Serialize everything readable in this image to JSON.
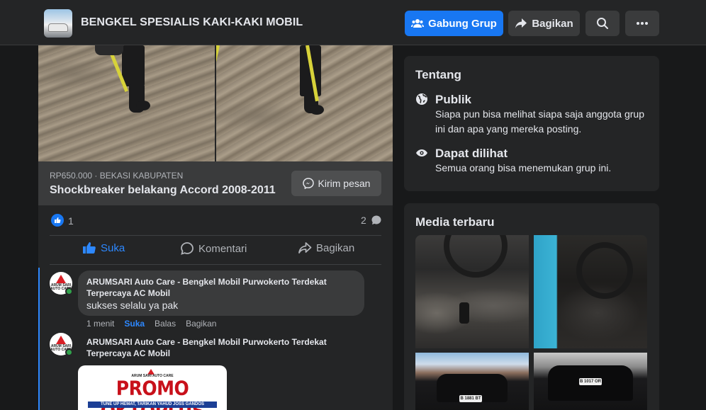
{
  "header": {
    "group_name": "BENGKEL SPESIALIS KAKI-KAKI MOBIL",
    "join_label": "Gabung Grup",
    "share_label": "Bagikan"
  },
  "listing": {
    "price_location": "RP650.000 · BEKASI KABUPATEN",
    "title": "Shockbreaker belakang Accord 2008-2011",
    "message_label": "Kirim pesan"
  },
  "reactions": {
    "like_count": "1",
    "comment_count": "2"
  },
  "actions": {
    "like": "Suka",
    "comment": "Komentari",
    "share": "Bagikan"
  },
  "comments": [
    {
      "avatar_text": "ARUM SARI AUTO CARE",
      "author": "ARUMSARI Auto Care - Bengkel Mobil Purwokerto Terdekat Terpercaya AC Mobil",
      "text": "sukses selalu ya pak",
      "time": "1 menit",
      "like": "Suka",
      "reply": "Balas",
      "share": "Bagikan"
    },
    {
      "avatar_text": "ARUM SARI AUTO CARE",
      "author": "ARUMSARI Auto Care - Bengkel Mobil Purwokerto Terdekat Terpercaya AC Mobil",
      "promo": {
        "logo_text": "ARUM SARI AUTO CARE",
        "title": "PROMO OKTOPLUS",
        "subtitle": "TUNE UP HEMAT, TARIKAN YAHUD JOSS GANDOS"
      }
    }
  ],
  "about": {
    "title": "Tentang",
    "public_title": "Publik",
    "public_desc": "Siapa pun bisa melihat siapa saja anggota grup ini dan apa yang mereka posting.",
    "visible_title": "Dapat dilihat",
    "visible_desc": "Semua orang bisa menemukan grup ini."
  },
  "media": {
    "title": "Media terbaru",
    "plates": [
      "B 1881 BT",
      "B 1017 OR"
    ]
  },
  "colors": {
    "accent": "#1877f2",
    "link": "#2d88ff",
    "card_bg": "#242526",
    "page_bg": "#18191a",
    "online": "#31a24c"
  }
}
